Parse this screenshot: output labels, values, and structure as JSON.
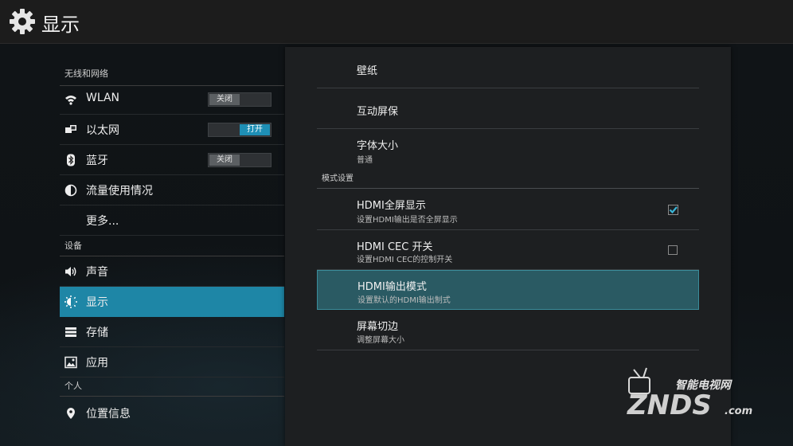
{
  "header": {
    "title": "显示",
    "icon": "gear-icon"
  },
  "sidebar": {
    "sections": [
      {
        "label": "无线和网络"
      },
      {
        "label": "设备"
      },
      {
        "label": "个人"
      }
    ],
    "items": [
      {
        "label": "WLAN",
        "icon": "wifi-icon",
        "toggle": "关闭",
        "toggle_state": "off"
      },
      {
        "label": "以太网",
        "icon": "ethernet-icon",
        "toggle": "打开",
        "toggle_state": "on"
      },
      {
        "label": "蓝牙",
        "icon": "bluetooth-icon",
        "toggle": "关闭",
        "toggle_state": "off"
      },
      {
        "label": "流量使用情况",
        "icon": "data-usage-icon"
      },
      {
        "label": "更多..."
      },
      {
        "label": "声音",
        "icon": "speaker-icon"
      },
      {
        "label": "显示",
        "icon": "display-icon",
        "selected": true
      },
      {
        "label": "存储",
        "icon": "storage-icon"
      },
      {
        "label": "应用",
        "icon": "apps-icon"
      },
      {
        "label": "位置信息",
        "icon": "location-icon"
      }
    ]
  },
  "main": {
    "items": [
      {
        "title": "壁纸"
      },
      {
        "title": "互动屏保"
      },
      {
        "title": "字体大小",
        "summary": "普通"
      }
    ],
    "category": "模式设置",
    "mode_items": [
      {
        "title": "HDMI全屏显示",
        "summary": "设置HDMI输出是否全屏显示",
        "checked": true
      },
      {
        "title": "HDMI CEC 开关",
        "summary": "设置HDMI CEC的控制开关",
        "checked": false
      },
      {
        "title": "HDMI输出模式",
        "summary": "设置默认的HDMI输出制式",
        "selected": true
      },
      {
        "title": "屏幕切边",
        "summary": "调整屏幕大小"
      }
    ]
  },
  "watermark": {
    "tagline": "智能电视网",
    "brand": "ZNDS",
    "suffix": ".com"
  },
  "colors": {
    "accent": "#1e86a6",
    "selected_row": "#2a5a63",
    "toggle_on": "#1e8fb5",
    "check": "#3ab6d8"
  }
}
